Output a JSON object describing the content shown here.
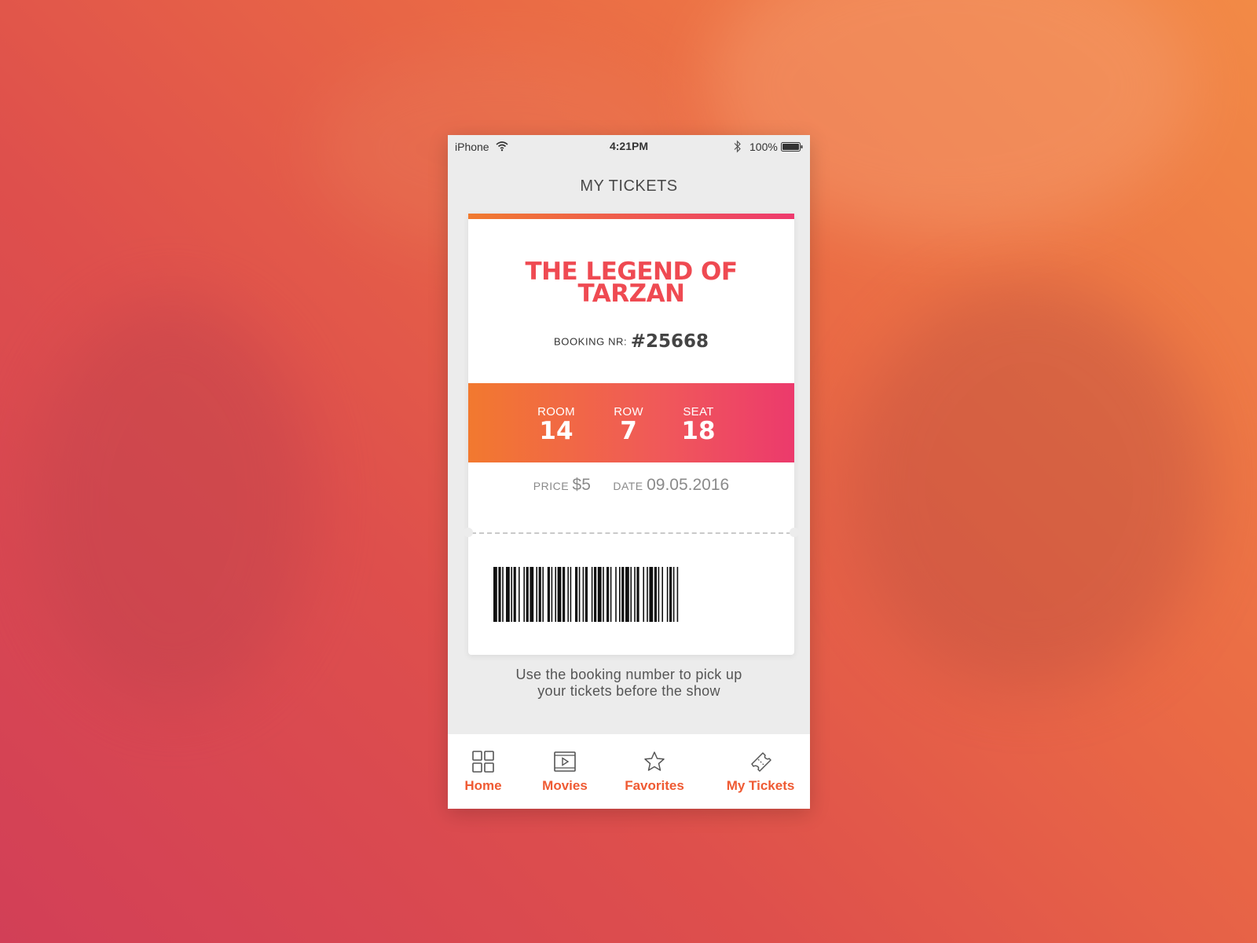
{
  "status_bar": {
    "carrier": "iPhone",
    "time": "4:21PM",
    "battery": "100%"
  },
  "screen": {
    "title": "MY TICKETS"
  },
  "ticket": {
    "movie_title_line1": "THE LEGEND OF",
    "movie_title_line2": "TARZAN",
    "booking_label": "BOOKING NR:",
    "booking_number": "#25668",
    "room_label": "ROOM",
    "room_value": "14",
    "row_label": "ROW",
    "row_value": "7",
    "seat_label": "SEAT",
    "seat_value": "18",
    "price_label": "PRICE",
    "price_value": "$5",
    "date_label": "DATE",
    "date_value": "09.05.2016"
  },
  "help_text": {
    "line1": "Use the booking number to pick up",
    "line2": "your tickets before the show"
  },
  "tabs": [
    {
      "label": "Home",
      "icon": "grid-icon"
    },
    {
      "label": "Movies",
      "icon": "film-icon"
    },
    {
      "label": "Favorites",
      "icon": "star-icon"
    },
    {
      "label": "My Tickets",
      "icon": "ticket-icon"
    }
  ],
  "colors": {
    "accent_orange": "#f2792f",
    "accent_pink": "#ec3a6c",
    "title_red": "#ef4a52",
    "tab_active": "#ef5a33"
  }
}
